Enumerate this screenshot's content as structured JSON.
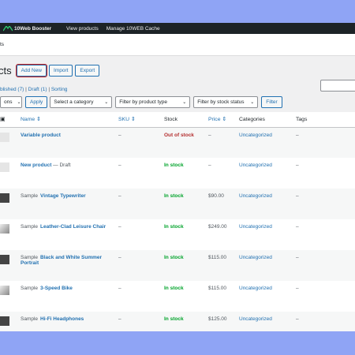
{
  "adminbar": {
    "brand": "10Web Booster",
    "items": [
      "View products",
      "Manage 10WEB Cache"
    ]
  },
  "subbar": {
    "text": "ts"
  },
  "page": {
    "title": "cts",
    "buttons": {
      "add_new": "Add New",
      "import": "Import",
      "export": "Export"
    }
  },
  "views": {
    "published": "blished (7)",
    "sep1": " | ",
    "draft": "Draft (1)",
    "sep2": " | ",
    "sorting": "Sorting"
  },
  "filters": {
    "bulk": "ons",
    "apply": "Apply",
    "category": "Select a category",
    "type": "Filter by product type",
    "stock": "Filter by stock status",
    "filter": "Filter"
  },
  "table": {
    "headers": {
      "name": "Name",
      "sku": "SKU",
      "stock": "Stock",
      "price": "Price",
      "categories": "Categories",
      "tags": "Tags"
    },
    "rows": [
      {
        "sample": "",
        "name": "Variable product",
        "suffix": "",
        "sku": "–",
        "stock": "Out of stock",
        "stock_status": "oos",
        "price": "–",
        "category": "Uncategorized",
        "tags": "–"
      },
      {
        "sample": "",
        "name": "New product",
        "suffix": " — Draft",
        "sku": "–",
        "stock": "In stock",
        "stock_status": "ins",
        "price": "–",
        "category": "Uncategorized",
        "tags": "–"
      },
      {
        "sample": "Sample",
        "name": "Vintage Typewriter",
        "suffix": "",
        "sku": "–",
        "stock": "In stock",
        "stock_status": "ins",
        "price": "$90.00",
        "category": "Uncategorized",
        "tags": "–"
      },
      {
        "sample": "Sample",
        "name": "Leather-Clad Leisure Chair",
        "suffix": "",
        "sku": "–",
        "stock": "In stock",
        "stock_status": "ins",
        "price": "$249.00",
        "category": "Uncategorized",
        "tags": "–"
      },
      {
        "sample": "Sample",
        "name": "Black and White Summer Portrait",
        "suffix": "",
        "sku": "–",
        "stock": "In stock",
        "stock_status": "ins",
        "price": "$115.00",
        "category": "Uncategorized",
        "tags": "–"
      },
      {
        "sample": "Sample",
        "name": "3-Speed Bike",
        "suffix": "",
        "sku": "–",
        "stock": "In stock",
        "stock_status": "ins",
        "price": "$115.00",
        "category": "Uncategorized",
        "tags": "–"
      },
      {
        "sample": "Sample",
        "name": "Hi-Fi Headphones",
        "suffix": "",
        "sku": "–",
        "stock": "In stock",
        "stock_status": "ins",
        "price": "$125.00",
        "category": "Uncategorized",
        "tags": "–"
      }
    ]
  },
  "colors": {
    "background": "#8fa4f5",
    "adminbar": "#1d2327",
    "link": "#2271b1",
    "highlight": "#c31d1d"
  }
}
